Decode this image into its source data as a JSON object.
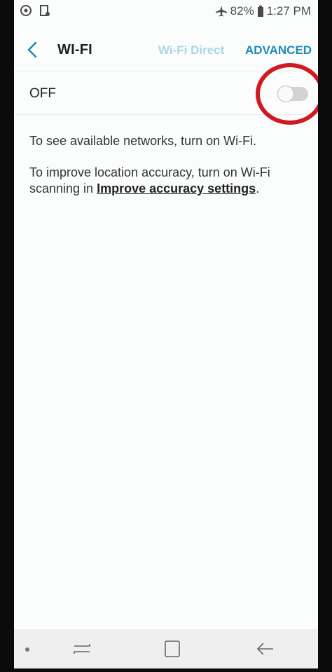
{
  "status_bar": {
    "battery": "82%",
    "time": "1:27 PM",
    "icons_left": [
      "sync-icon",
      "screenshot-icon"
    ],
    "icons_right": [
      "airplane-mode-icon",
      "battery-icon"
    ]
  },
  "app_bar": {
    "title": "WI-FI",
    "tab_wifi_direct": "Wi-Fi Direct",
    "tab_advanced": "ADVANCED",
    "accent_color": "#1d8ab8"
  },
  "toggle": {
    "label": "OFF",
    "state": "off"
  },
  "messages": {
    "networks_hint": "To see available networks, turn on Wi-Fi.",
    "accuracy_prefix": "To improve location accuracy, turn on Wi-Fi scanning in ",
    "accuracy_link": "Improve accuracy settings",
    "accuracy_suffix": "."
  },
  "nav_bar": {
    "items": [
      "recents-icon",
      "home-icon",
      "back-icon"
    ]
  },
  "annotation": {
    "color": "#d01a22",
    "target": "wifi-toggle"
  }
}
